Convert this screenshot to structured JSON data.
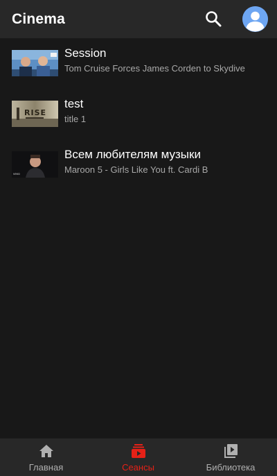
{
  "header": {
    "title": "Cinema",
    "search_icon": "search-icon",
    "avatar_icon": "account-icon",
    "avatar_color": "#6ea6f2"
  },
  "sessions": [
    {
      "title": "Session",
      "subtitle": "Tom Cruise Forces James Corden to Skydive",
      "thumbnail": "skydive-thumbnail"
    },
    {
      "title": "test",
      "subtitle": "title 1",
      "thumbnail": "rise-thumbnail"
    },
    {
      "title": "Всем любителям музыки",
      "subtitle": "Maroon 5 - Girls Like You ft. Cardi B",
      "thumbnail": "music-video-thumbnail"
    }
  ],
  "bottom_nav": {
    "items": [
      {
        "label": "Главная",
        "icon": "home-icon",
        "active": false
      },
      {
        "label": "Сеансы",
        "icon": "sessions-icon",
        "active": true
      },
      {
        "label": "Библиотека",
        "icon": "library-icon",
        "active": false
      }
    ],
    "active_color": "#e62117",
    "inactive_color": "#b0b0b0"
  },
  "colors": {
    "background": "#181818",
    "appbar": "#282828"
  }
}
